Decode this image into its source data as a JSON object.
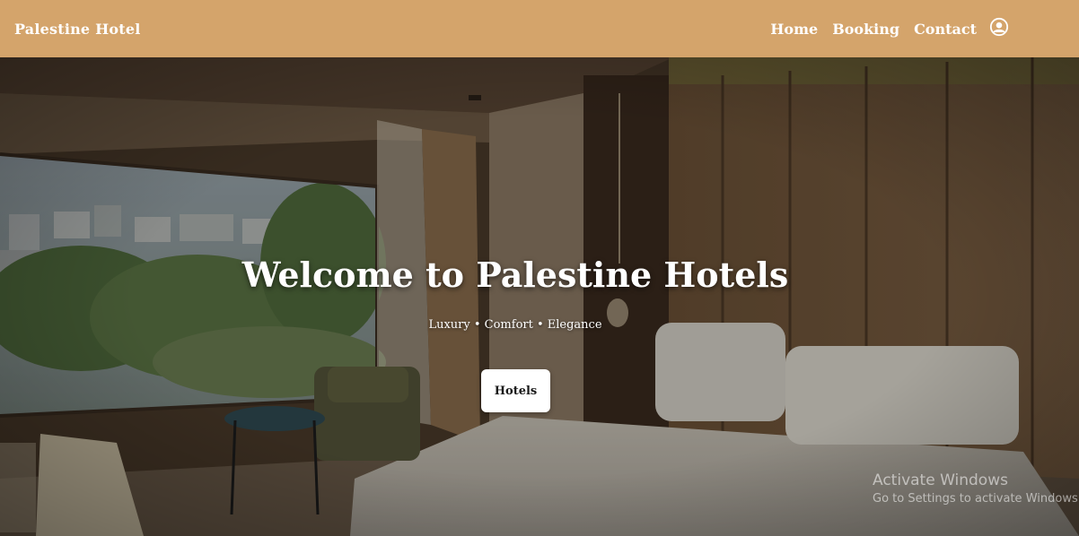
{
  "navbar": {
    "brand": "Palestine Hotel",
    "links": [
      "Home",
      "Booking",
      "Contact"
    ],
    "account_icon": "user-circle-icon",
    "background_color": "#d4a46b"
  },
  "hero": {
    "title": "Welcome to Palestine Hotels",
    "tagline": "Luxury • Comfort • Elegance",
    "button_label": "Hotels",
    "background_image": "hotel-room-photo"
  },
  "os_watermark": {
    "title": "Activate Windows",
    "subtitle": "Go to Settings to activate Windows."
  }
}
